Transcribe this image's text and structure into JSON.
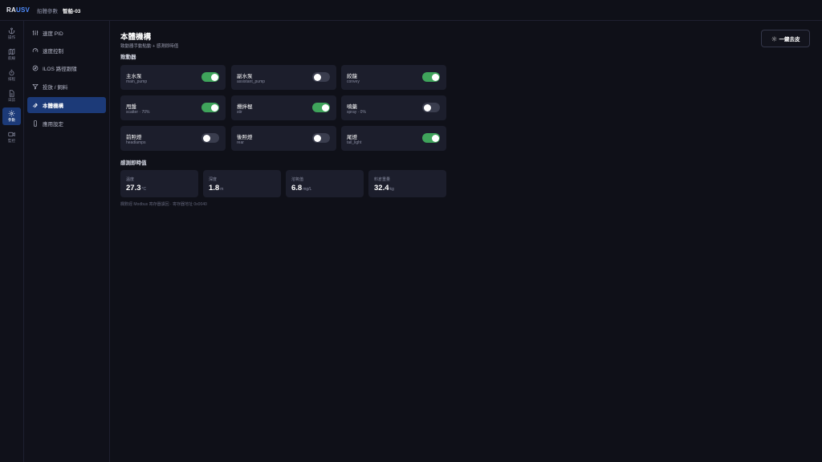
{
  "topbar": {
    "logo_a": "RA",
    "logo_b": "USV",
    "breadcrumb": "船體參數",
    "vessel": "智船-03"
  },
  "rail": [
    {
      "label": "操作",
      "icon": "anchor-icon"
    },
    {
      "label": "航線",
      "icon": "map-icon"
    },
    {
      "label": "排程",
      "icon": "timer-icon"
    },
    {
      "label": "日誌",
      "icon": "document-icon"
    },
    {
      "label": "參數",
      "icon": "gear-icon",
      "active": true
    },
    {
      "label": "監控",
      "icon": "camera-icon"
    }
  ],
  "sidenav": [
    {
      "label": "速度 PID",
      "icon": "sliders-icon"
    },
    {
      "label": "速度控制",
      "icon": "gauge-icon"
    },
    {
      "label": "ILOS 路徑跟隨",
      "icon": "compass-icon"
    },
    {
      "label": "投放 / 飼料",
      "icon": "funnel-icon"
    },
    {
      "label": "本體機構",
      "icon": "wrench-icon",
      "active": true
    },
    {
      "label": "應用設定",
      "icon": "phone-icon"
    }
  ],
  "main": {
    "title": "本體機構",
    "subtitle": "致動器手動點動 + 感測即時值",
    "actuators_label": "致動器",
    "sensors_label": "感測即時值",
    "shed_button": "一鍵去皮",
    "footnote": "欄數經 Modbus 寄存器讀回 · 寄存器地址 0x0040"
  },
  "actuators": [
    {
      "name": "主水泵",
      "code": "main_pump",
      "on": true
    },
    {
      "name": "副水泵",
      "code": "assistant_pump",
      "on": false
    },
    {
      "name": "絞龍",
      "code": "convey",
      "on": true
    },
    {
      "name": "甩盤",
      "code": "scatter · 70%",
      "on": true
    },
    {
      "name": "攪拌棍",
      "code": "stir",
      "on": true
    },
    {
      "name": "噴藥",
      "code": "spray · 0%",
      "on": false
    },
    {
      "name": "前照燈",
      "code": "headlamps",
      "on": false
    },
    {
      "name": "後照燈",
      "code": "rear",
      "on": false
    },
    {
      "name": "尾燈",
      "code": "tail_light",
      "on": true
    }
  ],
  "sensors": [
    {
      "label": "溫度",
      "value": "27.3",
      "unit": "°C"
    },
    {
      "label": "深度",
      "value": "1.8",
      "unit": "m"
    },
    {
      "label": "溶氧值",
      "value": "6.8",
      "unit": "mg/L"
    },
    {
      "label": "料倉重量",
      "value": "32.4",
      "unit": "kg"
    }
  ],
  "colors": {
    "background": "#0f1018",
    "accent": "#1c3a78",
    "toggle_on": "#3fa45b",
    "card": "#1c1e2c"
  }
}
